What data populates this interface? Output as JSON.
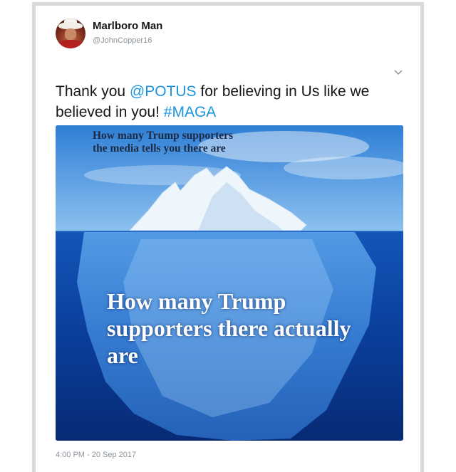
{
  "tweet": {
    "author_name": "Marlboro Man",
    "author_handle": "@JohnCopper16",
    "text_before": "Thank you ",
    "mention": "@POTUS",
    "text_middle": " for believing in Us like we believed in you! ",
    "hashtag": "#MAGA",
    "timestamp": "4:00 PM - 20 Sep 2017",
    "menu_icon": "chevron-down-icon",
    "link_color": "#1b95e0"
  },
  "media": {
    "caption_top": "How many Trump supporters the media tells you there are",
    "caption_bottom": "How many Trump supporters there actually are"
  }
}
